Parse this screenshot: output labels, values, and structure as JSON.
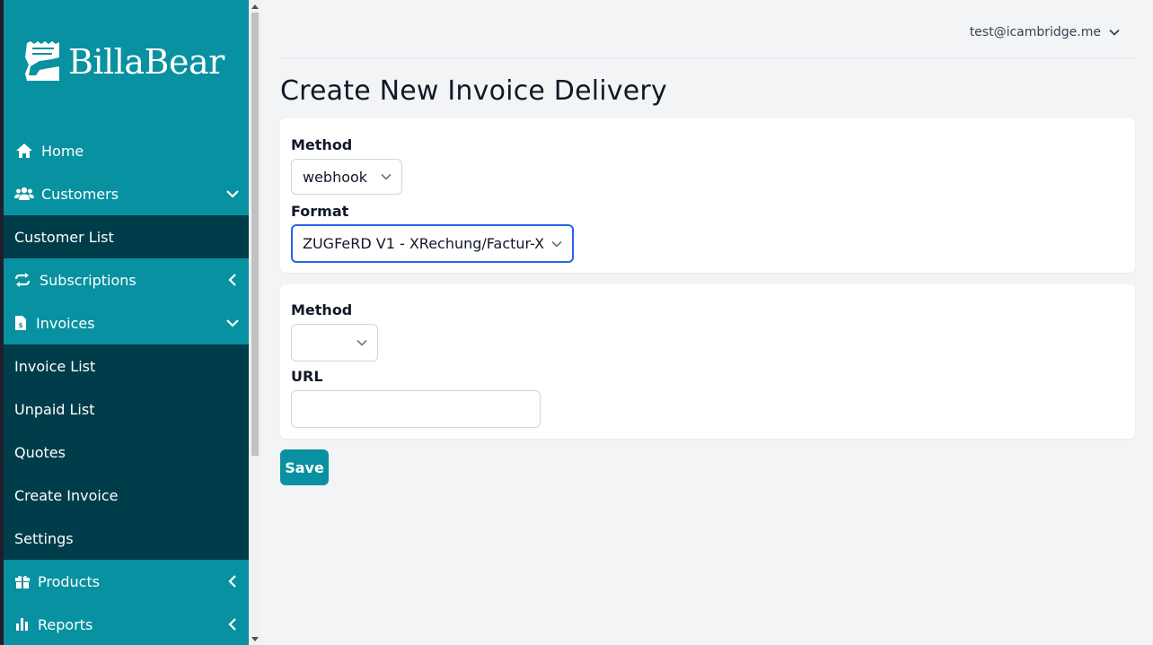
{
  "brand": {
    "name": "BillaBear",
    "logo_icon": "bear-logo-icon"
  },
  "user": {
    "email": "test@icambridge.me"
  },
  "sidebar": {
    "items": [
      {
        "label": "Home",
        "icon": "home-icon"
      },
      {
        "label": "Customers",
        "icon": "users-icon",
        "expanded": true,
        "children": [
          "Customer List"
        ]
      },
      {
        "label": "Subscriptions",
        "icon": "repeat-icon",
        "expanded": false
      },
      {
        "label": "Invoices",
        "icon": "invoice-icon",
        "expanded": true,
        "children": [
          "Invoice List",
          "Unpaid List",
          "Quotes",
          "Create Invoice",
          "Settings"
        ]
      },
      {
        "label": "Products",
        "icon": "gift-icon",
        "expanded": false
      },
      {
        "label": "Reports",
        "icon": "bar-chart-icon",
        "expanded": false
      }
    ]
  },
  "page": {
    "title": "Create New Invoice Delivery"
  },
  "form1": {
    "method_label": "Method",
    "method_value": "webhook",
    "format_label": "Format",
    "format_value": "ZUGFeRD V1 - XRechung/Factur-X"
  },
  "form2": {
    "method_label": "Method",
    "method_value": "",
    "url_label": "URL",
    "url_value": ""
  },
  "actions": {
    "save_label": "Save"
  },
  "colors": {
    "sidebar": "#0891a0",
    "submenu": "#003d4a",
    "accent": "#0891a0",
    "focus": "#2563eb"
  }
}
